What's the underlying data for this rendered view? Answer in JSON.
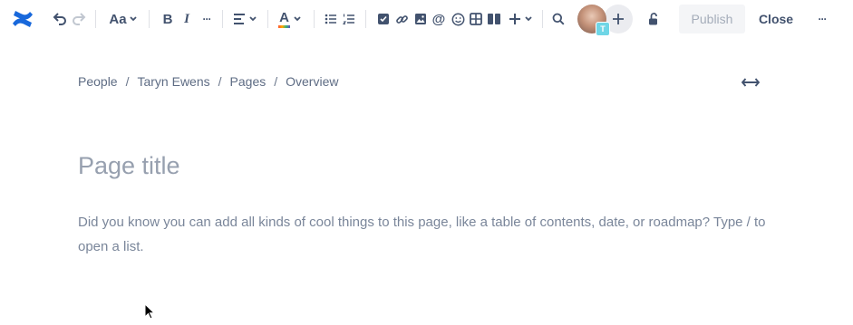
{
  "toolbar": {
    "text_style_label": "Aa",
    "bold_label": "B",
    "italic_label": "I",
    "more_label": "···",
    "font_color_label": "A",
    "collaborator_badge": "T",
    "publish_label": "Publish",
    "close_label": "Close",
    "more_actions_label": "···"
  },
  "breadcrumb": {
    "items": [
      "People",
      "Taryn Ewens",
      "Pages",
      "Overview"
    ],
    "separator": "/"
  },
  "editor": {
    "title_placeholder": "Page title",
    "body_placeholder": "Did you know you can add all kinds of cool things to this page, like a table of contents, date, or roadmap? Type / to open a list."
  },
  "colors": {
    "brand": "#1868DB",
    "text": "#42526E",
    "placeholder": "#97A0AF",
    "publish_bg": "#F4F5F7"
  }
}
